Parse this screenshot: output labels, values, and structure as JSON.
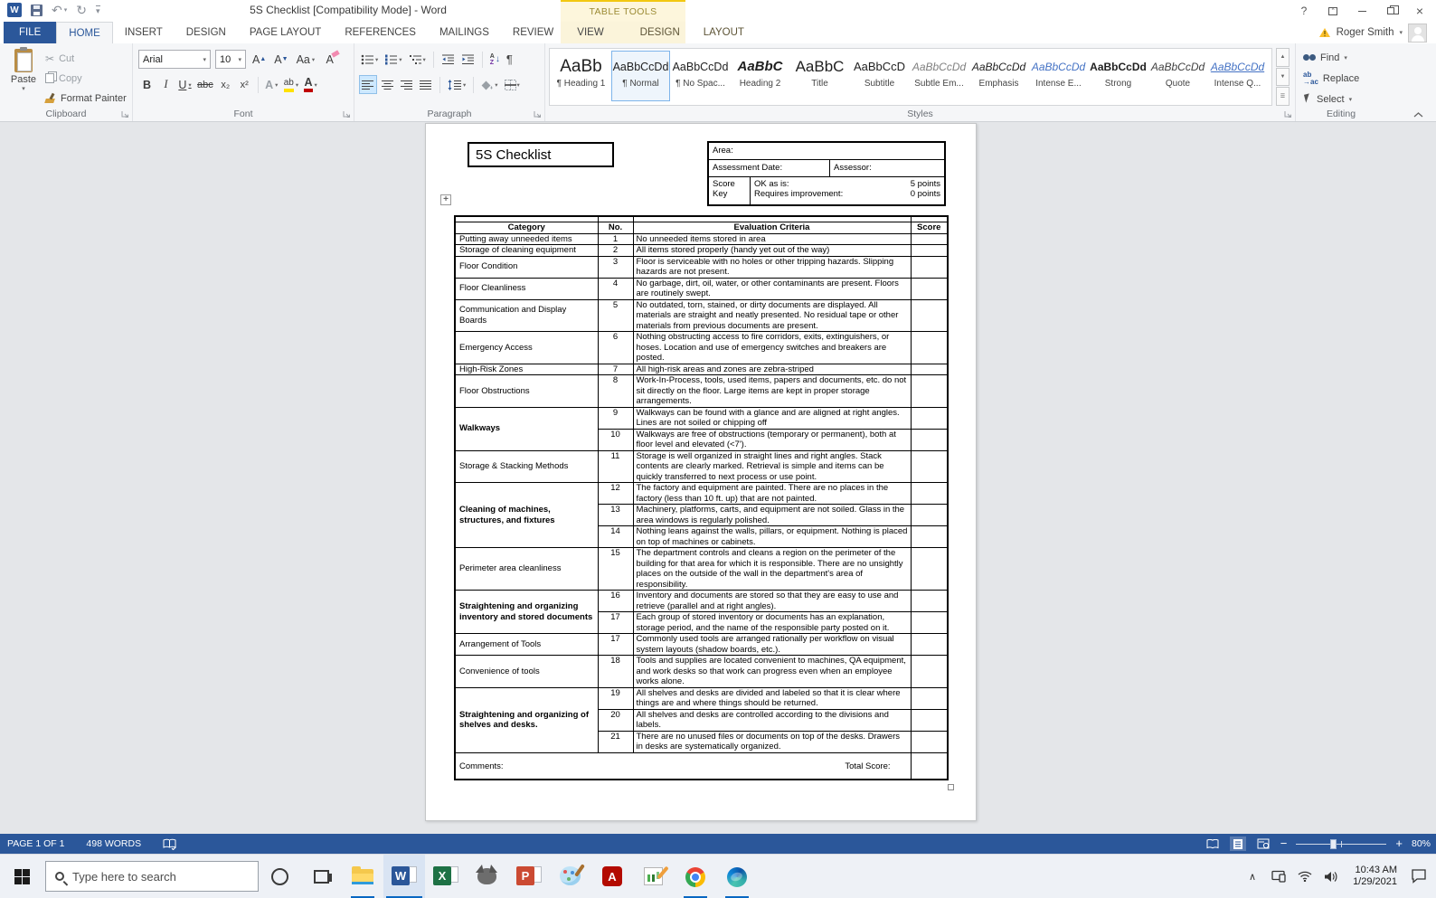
{
  "titlebar": {
    "title": "5S Checklist [Compatibility Mode] - Word",
    "context_tab_group": "TABLE TOOLS",
    "user": "Roger Smith",
    "help_glyph": "?",
    "close_glyph": "×"
  },
  "tabs": [
    "FILE",
    "HOME",
    "INSERT",
    "DESIGN",
    "PAGE LAYOUT",
    "REFERENCES",
    "MAILINGS",
    "REVIEW",
    "VIEW"
  ],
  "context_tabs": [
    "DESIGN",
    "LAYOUT"
  ],
  "active_tab": "HOME",
  "ribbon": {
    "clipboard": {
      "label": "Clipboard",
      "paste": "Paste",
      "cut": "Cut",
      "copy": "Copy",
      "format_painter": "Format Painter"
    },
    "font": {
      "label": "Font",
      "font_name": "Arial",
      "font_size": "10",
      "icons": {
        "bold": "B",
        "italic": "I",
        "underline": "U",
        "strikethrough": "abc",
        "subscript": "x₂",
        "superscript": "x²",
        "grow": "A",
        "shrink": "A",
        "change_case": "Aa",
        "clear": "A",
        "text_effects": "A",
        "highlight": "ab",
        "font_color": "A"
      }
    },
    "paragraph": {
      "label": "Paragraph",
      "icons": {
        "pilcrow": "¶",
        "sort_a": "A",
        "sort_z": "Z",
        "sort_arrow": "↓"
      }
    },
    "styles": {
      "label": "Styles",
      "items": [
        {
          "preview": "AaBb",
          "label": "¶ Heading 1",
          "cls": "s-h1",
          "selected": false
        },
        {
          "preview": "AaBbCcDd",
          "label": "¶ Normal",
          "cls": "s-normal",
          "selected": true
        },
        {
          "preview": "AaBbCcDd",
          "label": "¶ No Spac...",
          "cls": "s-normal",
          "selected": false
        },
        {
          "preview": "AaBbC",
          "label": "Heading 2",
          "cls": "s-h2",
          "selected": false
        },
        {
          "preview": "AaBbC",
          "label": "Title",
          "cls": "s-title",
          "selected": false
        },
        {
          "preview": "AaBbCcD",
          "label": "Subtitle",
          "cls": "s-subtitle",
          "selected": false
        },
        {
          "preview": "AaBbCcDd",
          "label": "Subtle Em...",
          "cls": "s-subtle",
          "selected": false
        },
        {
          "preview": "AaBbCcDd",
          "label": "Emphasis",
          "cls": "s-emph",
          "selected": false
        },
        {
          "preview": "AaBbCcDd",
          "label": "Intense E...",
          "cls": "s-intense",
          "selected": false
        },
        {
          "preview": "AaBbCcDd",
          "label": "Strong",
          "cls": "s-strong",
          "selected": false
        },
        {
          "preview": "AaBbCcDd",
          "label": "Quote",
          "cls": "s-quote",
          "selected": false
        },
        {
          "preview": "AaBbCcDd",
          "label": "Intense Q...",
          "cls": "s-intenseq",
          "selected": false
        }
      ]
    },
    "editing": {
      "label": "Editing",
      "find": "Find",
      "replace": "Replace",
      "select": "Select"
    }
  },
  "document": {
    "title": "5S Checklist",
    "info": {
      "area": "Area:",
      "assessment_date": "Assessment Date:",
      "assessor": "Assessor:",
      "score_key": "Score Key",
      "ok_as_is": "OK as is:",
      "ok_points": "5 points",
      "requires_improvement": "Requires improvement:",
      "ri_points": "0 points"
    },
    "table": {
      "headers": [
        "Category",
        "No.",
        "Evaluation Criteria",
        "Score"
      ],
      "comments_label": "Comments:",
      "total_score_label": "Total Score:",
      "rows": [
        {
          "category": "Putting away unneeded items",
          "span": 1,
          "bold": false,
          "no": "1",
          "criteria": "No unneeded items stored in area"
        },
        {
          "category": "Storage of cleaning equipment",
          "span": 1,
          "bold": false,
          "no": "2",
          "criteria": "All items stored properly (handy yet out of the way)"
        },
        {
          "category": "Floor Condition",
          "span": 1,
          "bold": false,
          "no": "3",
          "criteria": "Floor is serviceable with no holes or other tripping hazards.  Slipping hazards are not present."
        },
        {
          "category": "Floor Cleanliness",
          "span": 1,
          "bold": false,
          "no": "4",
          "criteria": "No garbage, dirt, oil, water, or other contaminants are present.  Floors are routinely swept."
        },
        {
          "category": "Communication and Display Boards",
          "span": 1,
          "bold": false,
          "no": "5",
          "criteria": "No outdated, torn, stained, or dirty documents are displayed.  All materials are straight and neatly presented.  No residual tape or other materials from previous documents are present."
        },
        {
          "category": "Emergency Access",
          "span": 1,
          "bold": false,
          "no": "6",
          "criteria": "Nothing obstructing access to fire corridors, exits, extinguishers, or hoses.  Location and use of emergency switches and breakers are posted."
        },
        {
          "category": "High-Risk Zones",
          "span": 1,
          "bold": false,
          "no": "7",
          "criteria": "All high-risk areas and zones are zebra-striped"
        },
        {
          "category": "Floor Obstructions",
          "span": 1,
          "bold": false,
          "no": "8",
          "criteria": "Work-In-Process, tools, used items, papers and documents, etc. do not sit directly on the floor.  Large items are kept in proper storage arrangements."
        },
        {
          "category": "Walkways",
          "span": 2,
          "bold": true,
          "no": "9",
          "criteria": "Walkways can be found with a glance and are aligned at right angles.  Lines are not soiled or chipping off"
        },
        {
          "category": null,
          "span": 0,
          "bold": false,
          "no": "10",
          "criteria": "Walkways are free of obstructions (temporary or permanent), both at floor level and elevated (<7')."
        },
        {
          "category": "Storage & Stacking Methods",
          "span": 1,
          "bold": false,
          "no": "11",
          "criteria": "Storage is well organized in straight lines and right angles.  Stack contents are clearly marked.  Retrieval is simple and items can be quickly transferred to next process or use point."
        },
        {
          "category": "Cleaning of machines, structures, and fixtures",
          "span": 3,
          "bold": true,
          "no": "12",
          "criteria": "The factory and equipment are painted.  There are no places in the factory (less than 10 ft. up) that are not painted."
        },
        {
          "category": null,
          "span": 0,
          "bold": false,
          "no": "13",
          "criteria": "Machinery, platforms, carts, and equipment are not soiled.  Glass in the area windows is regularly polished."
        },
        {
          "category": null,
          "span": 0,
          "bold": false,
          "no": "14",
          "criteria": "Nothing leans against the walls, pillars, or equipment.  Nothing is placed on top of machines or cabinets."
        },
        {
          "category": "Perimeter area cleanliness",
          "span": 1,
          "bold": false,
          "no": "15",
          "criteria": "The department controls and cleans a region on the perimeter of the building for that area for which it is responsible.  There are no unsightly places on the outside of the wall in the department's area of responsibility."
        },
        {
          "category": "Straightening and organizing inventory and stored documents",
          "span": 2,
          "bold": true,
          "no": "16",
          "criteria": "Inventory and documents are stored so that they are easy to use and retrieve (parallel and at right angles)."
        },
        {
          "category": null,
          "span": 0,
          "bold": false,
          "no": "17",
          "criteria": "Each group of stored inventory or documents has an explanation, storage period, and the name of the responsible party posted on it."
        },
        {
          "category": "Arrangement of Tools",
          "span": 1,
          "bold": false,
          "no": "17",
          "criteria": "Commonly used tools are arranged rationally per workflow on visual system layouts (shadow boards, etc.)."
        },
        {
          "category": "Convenience of tools",
          "span": 1,
          "bold": false,
          "no": "18",
          "criteria": "Tools and supplies are located convenient to machines, QA equipment, and work desks so that work can progress even when an employee works alone."
        },
        {
          "category": "Straightening and organizing of shelves and desks.",
          "span": 3,
          "bold": true,
          "no": "19",
          "criteria": "All shelves and desks are divided and labeled so that it is clear where things are and where things should be returned."
        },
        {
          "category": null,
          "span": 0,
          "bold": false,
          "no": "20",
          "criteria": "All shelves and desks are controlled according to the divisions and labels."
        },
        {
          "category": null,
          "span": 0,
          "bold": false,
          "no": "21",
          "criteria": "There are no unused files or documents on top of the desks.  Drawers in desks are systematically organized."
        }
      ]
    }
  },
  "status_bar": {
    "page": "PAGE 1 OF 1",
    "words": "498 WORDS",
    "zoom_level": "80%"
  },
  "taskbar": {
    "search_placeholder": "Type here to search",
    "apps": [
      "file-explorer",
      "word",
      "excel",
      "gimp",
      "powerpoint",
      "paint3d",
      "acrobat",
      "photo-editor",
      "chrome",
      "edge"
    ],
    "running_apps": [
      "file-explorer",
      "word",
      "chrome",
      "edge"
    ],
    "active_app": "word",
    "clock_time": "10:43 AM",
    "clock_date": "1/29/2021"
  }
}
